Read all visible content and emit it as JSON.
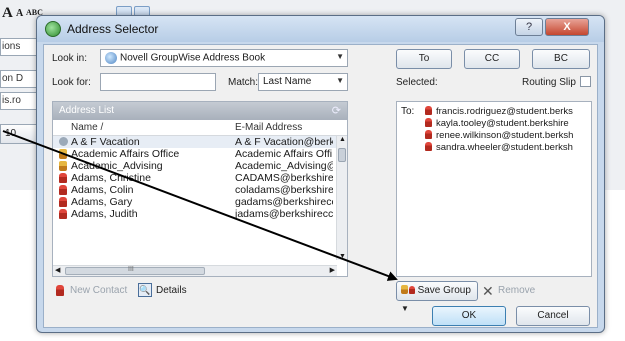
{
  "background": {
    "toolbar_letters": [
      "A",
      "A",
      "ABC"
    ],
    "fields": [
      "ions",
      "on D",
      "is.ro"
    ],
    "tab": "10"
  },
  "dialog": {
    "title": "Address Selector",
    "help_label": "?",
    "close_label": "X",
    "look_in": {
      "label": "Look in:",
      "value": "Novell GroupWise Address Book"
    },
    "look_for": {
      "label": "Look for:",
      "value": ""
    },
    "match": {
      "label": "Match:",
      "value": "Last Name"
    },
    "address_list": {
      "header": "Address List",
      "columns": {
        "name": "Name /",
        "email": "E-Mail Address"
      },
      "rows": [
        {
          "type": "resource",
          "name": "A & F Vacation",
          "email": "A & F Vacation@berk"
        },
        {
          "type": "group",
          "name": "Academic Affairs Office",
          "email": "Academic Affairs Offi"
        },
        {
          "type": "group",
          "name": "Academic_Advising",
          "email": "Academic_Advising@"
        },
        {
          "type": "person",
          "name": "Adams, Christine",
          "email": "CADAMS@berkshirec"
        },
        {
          "type": "person",
          "name": "Adams, Colin",
          "email": "coladams@berkshirec"
        },
        {
          "type": "person",
          "name": "Adams, Gary",
          "email": "gadams@berkshirecc"
        },
        {
          "type": "person",
          "name": "Adams, Judith",
          "email": "jadams@berkshirecc.c"
        }
      ],
      "scroll_marker": "III"
    },
    "buttons": {
      "to": "To",
      "cc": "CC",
      "bc": "BC",
      "new_contact": "New Contact",
      "details": "Details",
      "save_group": "Save Group",
      "remove": "Remove",
      "ok": "OK",
      "cancel": "Cancel"
    },
    "selected": {
      "label": "Selected:",
      "routing_slip": "Routing Slip",
      "routing_slip_checked": false,
      "to_label": "To:",
      "recipients": [
        "francis.rodriguez@student.berks",
        "kayla.tooley@student.berkshire",
        "renee.wilkinson@student.berksh",
        "sandra.wheeler@student.berksh"
      ]
    }
  },
  "colors": {
    "title_bar": "#c7d8ec",
    "close_button": "#c5472f",
    "person_icon": "#b22a1f",
    "group_icon": "#e6b640",
    "annotation_arrow": "#000000"
  }
}
